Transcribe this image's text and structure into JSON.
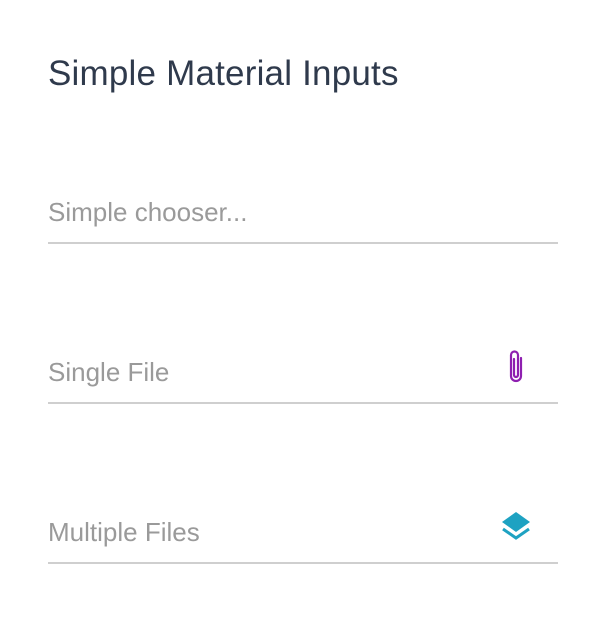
{
  "page": {
    "title": "Simple Material Inputs"
  },
  "inputs": [
    {
      "label": "Simple chooser...",
      "icon": null
    },
    {
      "label": "Single File",
      "icon": "paperclip-icon",
      "icon_color": "#8e1fb0"
    },
    {
      "label": "Multiple Files",
      "icon": "layers-icon",
      "icon_color": "#1ea2c2"
    }
  ],
  "colors": {
    "title": "#2f3a4c",
    "label": "#9a9a9a",
    "underline": "#cfcfcf",
    "attach_icon": "#8e1fb0",
    "layers_icon": "#1ea2c2"
  }
}
